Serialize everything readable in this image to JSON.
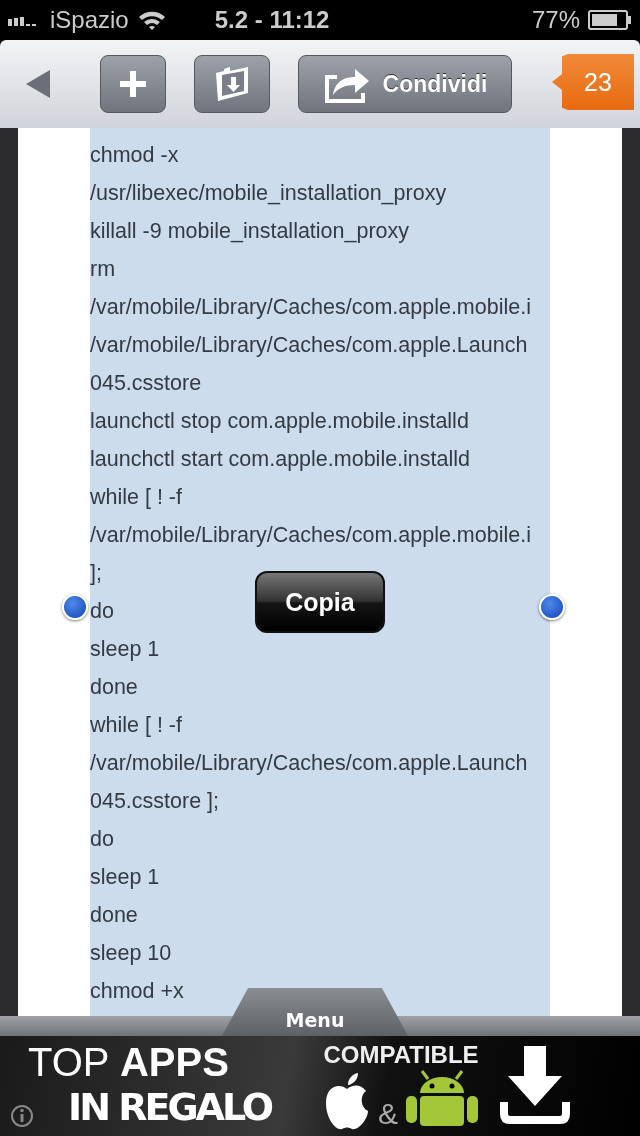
{
  "status_bar": {
    "carrier": "iSpazio",
    "time": "5.2 - 11:12",
    "battery": "77%"
  },
  "toolbar": {
    "share_label": "Condividi",
    "badge": "23"
  },
  "code_lines": [
    "chmod -x",
    "/usr/libexec/mobile_installation_proxy",
    "killall -9 mobile_installation_proxy",
    "rm",
    "/var/mobile/Library/Caches/com.apple.mobile.i",
    "/var/mobile/Library/Caches/com.apple.Launch",
    "045.csstore",
    "launchctl stop com.apple.mobile.installd",
    "launchctl start com.apple.mobile.installd",
    "while [ ! -f",
    "/var/mobile/Library/Caches/com.apple.mobile.i",
    "];",
    "do",
    "sleep 1",
    "done",
    "while [ ! -f",
    "/var/mobile/Library/Caches/com.apple.Launch",
    "045.csstore ];",
    "do",
    "sleep 1",
    "done",
    "sleep 10",
    "chmod +x"
  ],
  "callout": {
    "label": "Copia"
  },
  "menu_tab": {
    "label": "Menu"
  },
  "ad_banner": {
    "headline": "TOP",
    "headline_bold": "APPS",
    "subline": "IN REGALO",
    "compat": "COMPATIBLE",
    "amp": "&"
  }
}
